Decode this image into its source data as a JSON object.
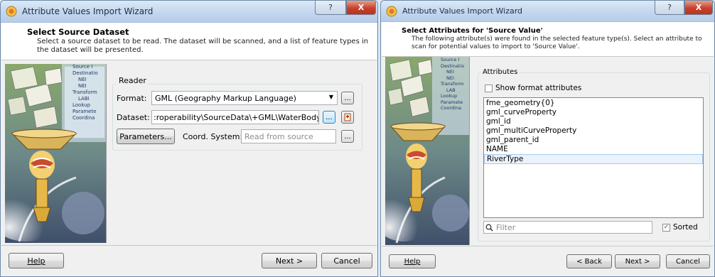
{
  "colors": {
    "title_bar": "#c3d7ee",
    "close_button": "#c7412b",
    "selection": "#eaf2fb"
  },
  "window1": {
    "title": "Attribute Values Import Wizard",
    "help_button": "?",
    "close_button": "X",
    "header_title": "Select Source Dataset",
    "header_desc": "Select a source dataset to be read. The dataset will be scanned, and a list of feature types in the dataset will be presented.",
    "reader_group": "Reader",
    "format_label": "Format:",
    "format_value": "GML (Geography Markup Language)",
    "dataset_label": "Dataset:",
    "dataset_value": ":roperability\\SourceData\\+GML\\WaterBody.gml\"",
    "browse_label": "...",
    "parameters_button": "Parameters...",
    "coord_label": "Coord. System:",
    "coord_placeholder": "Read from source",
    "footer": {
      "help": "Help",
      "next": "Next >",
      "cancel": "Cancel"
    }
  },
  "window2": {
    "title": "Attribute Values Import Wizard",
    "help_button": "?",
    "close_button": "X",
    "header_title": "Select Attributes for 'Source Value'",
    "header_desc": "The following attribute(s) were found in the selected feature type(s). Select an attribute to scan for potential values to import to 'Source Value'.",
    "attributes_group": "Attributes",
    "show_format_label": "Show format attributes",
    "attributes": [
      "fme_geometry{0}",
      "gml_curveProperty",
      "gml_id",
      "gml_multiCurveProperty",
      "gml_parent_id",
      "NAME",
      "RiverType"
    ],
    "selected_index": 6,
    "filter_placeholder": "Filter",
    "sorted_label": "Sorted",
    "footer": {
      "help": "Help",
      "back": "< Back",
      "next": "Next >",
      "cancel": "Cancel"
    }
  },
  "sidebar_labels": {
    "side1": [
      "Source I",
      "Destinatio",
      "NEI",
      "NEI",
      "Transform",
      "LABI",
      "Lookup",
      "Paramete",
      "Coordina"
    ],
    "side2": [
      "Source I",
      "Destinatio",
      "NEI",
      "NEI",
      "Transform",
      "LAB",
      "Lookup",
      "Paramete",
      "Coordina"
    ]
  }
}
